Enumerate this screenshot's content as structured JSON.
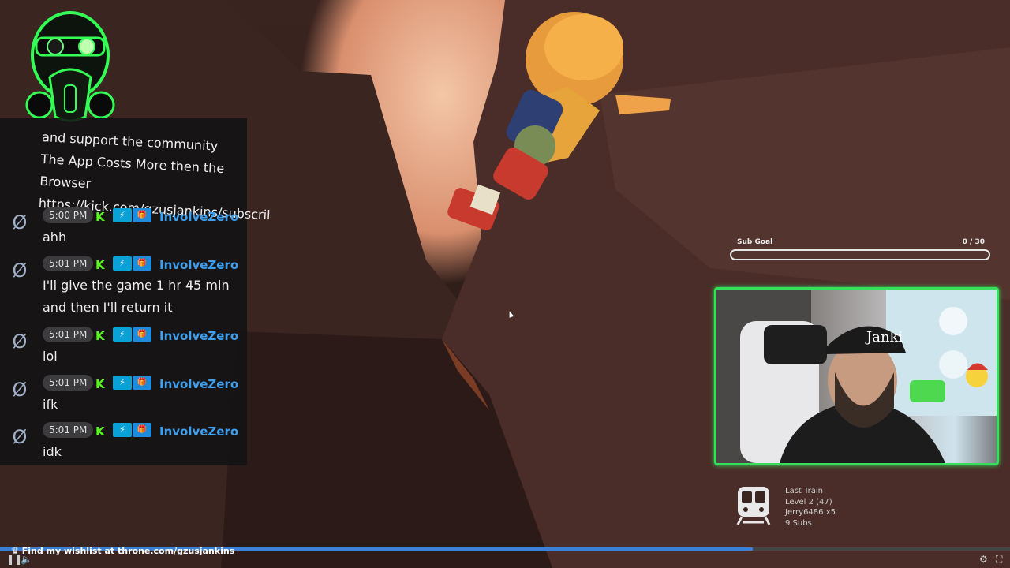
{
  "chat": {
    "top_text": "and support the community The App Costs More then the Browser https://kick.com/gzusjankins/subscril",
    "messages": [
      {
        "time": "5:00 PM",
        "user": "InvolveZero",
        "text": "ahh"
      },
      {
        "time": "5:01 PM",
        "user": "InvolveZero",
        "text": "I'll give the game 1 hr 45 min and then I'll return it"
      },
      {
        "time": "5:01 PM",
        "user": "InvolveZero",
        "text": "lol"
      },
      {
        "time": "5:01 PM",
        "user": "InvolveZero",
        "text": "ifk"
      },
      {
        "time": "5:01 PM",
        "user": "InvolveZero",
        "text": "idk"
      }
    ]
  },
  "sub_goal": {
    "label": "Sub Goal",
    "count": "0 / 30",
    "progress": 0
  },
  "webcam": {
    "hat_text": "Janki"
  },
  "event": {
    "title": "Last Train",
    "level": "Level 2  (47)",
    "user": "Jerry6486 x5",
    "subs": "9 Subs"
  },
  "player": {
    "ticker": "Find my wishlist at throne.com/gzusjankins",
    "progress": 0.745
  },
  "colors": {
    "chat_user": "#3d9ff0",
    "cam_border": "#35e05a",
    "progress": "#3b82d6"
  },
  "icons": [
    "gas-mask-skull-icon",
    "kick-badge-icon",
    "train-icon",
    "play-icon",
    "volume-icon",
    "settings-icon",
    "fullscreen-icon"
  ]
}
